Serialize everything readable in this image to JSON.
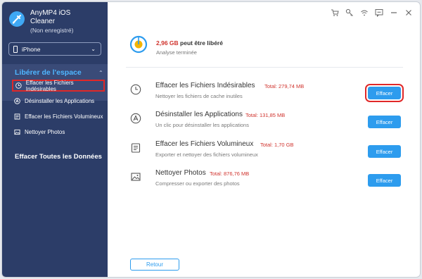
{
  "app": {
    "name": "AnyMP4 iOS",
    "name_line2": "Cleaner",
    "status": "(Non enregistré)"
  },
  "device": {
    "selected": "iPhone"
  },
  "sidebar": {
    "section_title": "Libérer de l'espace",
    "items": [
      {
        "label": "Effacer les Fichiers Indésirables",
        "icon": "clock-icon",
        "active": true
      },
      {
        "label": "Désinstaller les Applications",
        "icon": "apps-icon",
        "active": false
      },
      {
        "label": "Effacer les Fichiers Volumineux",
        "icon": "document-icon",
        "active": false
      },
      {
        "label": "Nettoyer Photos",
        "icon": "photo-icon",
        "active": false
      }
    ],
    "section2_title": "Effacer Toutes les Données"
  },
  "summary": {
    "size": "2,96 GB",
    "size_suffix": "peut être libéré",
    "status": "Analyse terminée"
  },
  "rows": [
    {
      "title": "Effacer les Fichiers Indésirables",
      "total": "Total: 279,74 MB",
      "desc": "Nettoyer les fichiers de cache inutiles",
      "button": "Effacer"
    },
    {
      "title": "Désinstaller les Applications",
      "total": "Total: 131,85 MB",
      "desc": "Un clic pour désinstaller les applications",
      "button": "Effacer"
    },
    {
      "title": "Effacer les Fichiers Volumineux",
      "total": "Total: 1,70 GB",
      "desc": "Exporter et nettoyer des fichiers volumineux",
      "button": "Effacer"
    },
    {
      "title": "Nettoyer Photos",
      "total": "Total: 876,76 MB",
      "desc": "Compresser ou exporter des photos",
      "button": "Effacer"
    }
  ],
  "footer": {
    "back_label": "Retour"
  },
  "colors": {
    "sidebar_bg": "#2c3d68",
    "accent": "#2d9cee",
    "red": "#d0332d",
    "section_title": "#4fb6ff"
  }
}
